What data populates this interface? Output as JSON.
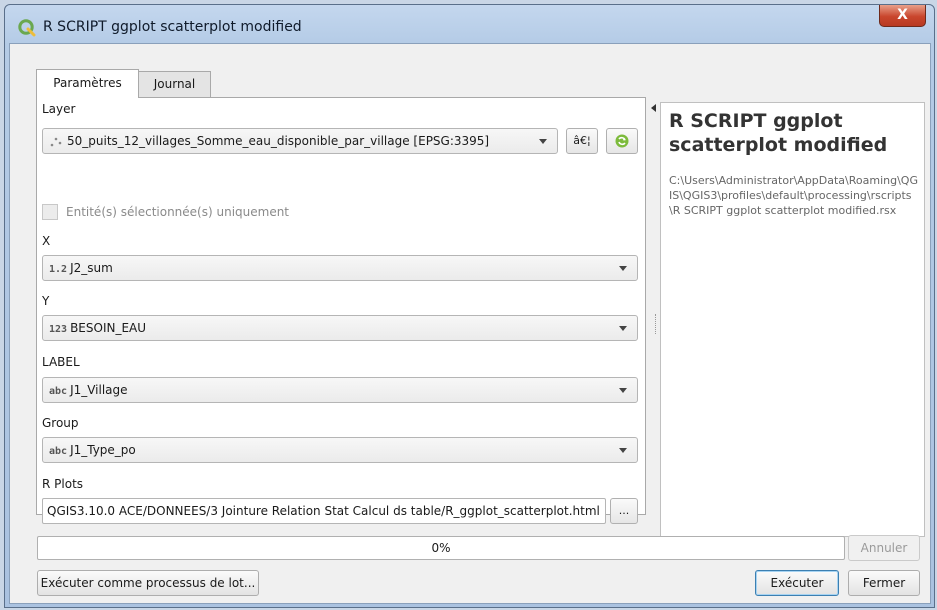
{
  "window": {
    "title": "R SCRIPT ggplot scatterplot modified",
    "close_label": "X"
  },
  "tabs": [
    {
      "label": "Paramètres",
      "active": true
    },
    {
      "label": "Journal",
      "active": false
    }
  ],
  "form": {
    "layer": {
      "label": "Layer",
      "value": "50_puits_12_villages_Somme_eau_disponible_par_village [EPSG:3395]",
      "icon": "point-layer-icon",
      "browse_label": "â€¦"
    },
    "selected_only": {
      "label": "Entité(s) sélectionnée(s) uniquement",
      "checked": false
    },
    "x": {
      "label": "X",
      "type_badge": "1.2",
      "value": "J2_sum"
    },
    "y": {
      "label": "Y",
      "type_badge": "123",
      "value": "BESOIN_EAU"
    },
    "label_field": {
      "label": "LABEL",
      "type_badge": "abc",
      "value": "J1_Village"
    },
    "group": {
      "label": "Group",
      "type_badge": "abc",
      "value": "J1_Type_po"
    },
    "r_plots": {
      "label": "R Plots",
      "value": "QGIS3.10.0 ACE/DONNEES/3 Jointure Relation Stat Calcul ds table/R_ggplot_scatterplot.html",
      "browse_label": "..."
    }
  },
  "help": {
    "title": "R SCRIPT ggplot scatterplot modified",
    "path": "C:\\Users\\Administrator\\AppData\\Roaming\\QGIS\\QGIS3\\profiles\\default\\processing\\rscripts\\R SCRIPT ggplot scatterplot modified.rsx"
  },
  "progress": {
    "text": "0%",
    "value": 0
  },
  "buttons": {
    "cancel": "Annuler",
    "batch": "Exécuter comme processus de lot...",
    "run": "Exécuter",
    "close": "Fermer"
  },
  "colors": {
    "qgis_green": "#6aa84f",
    "title_bar": "#b4cbe6",
    "close_red": "#c9462d"
  }
}
